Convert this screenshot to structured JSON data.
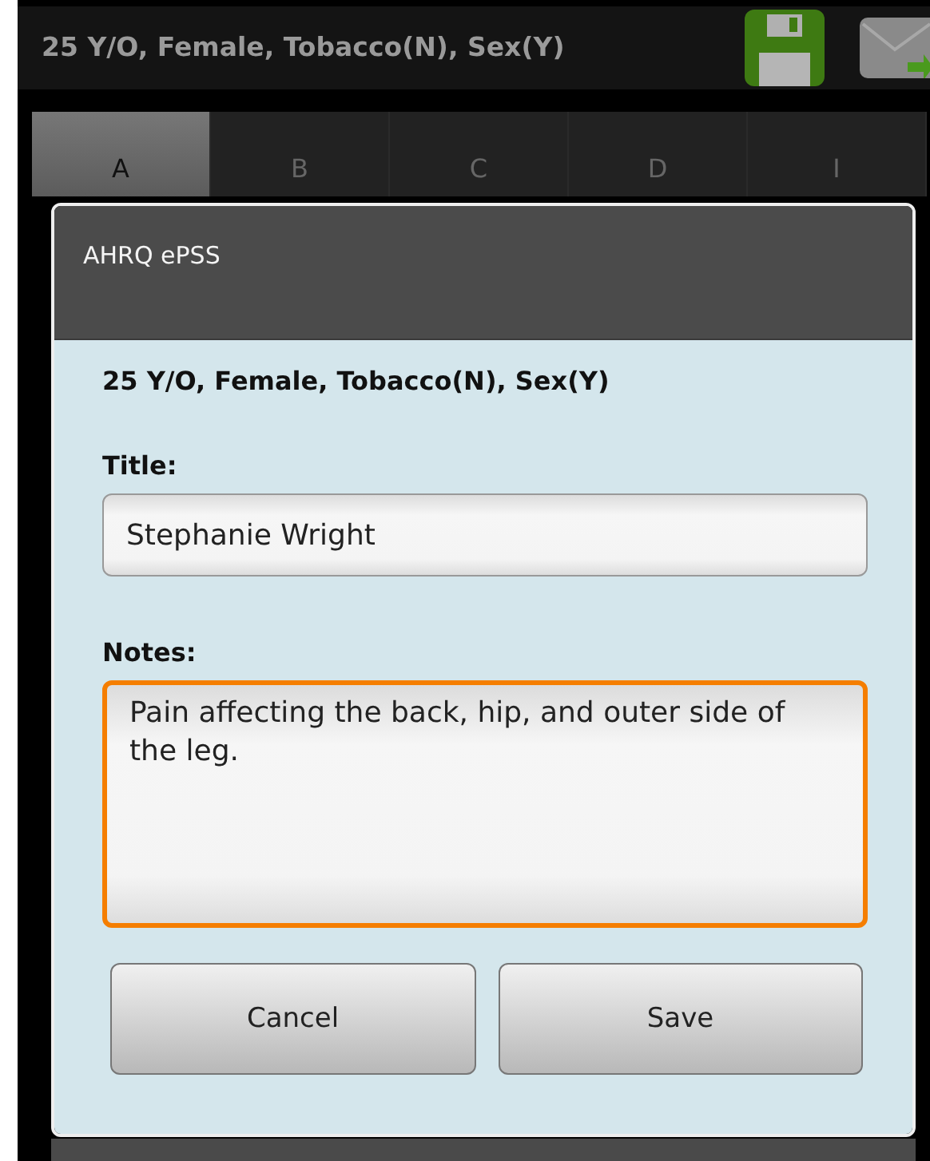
{
  "action_bar": {
    "title": "25 Y/O, Female, Tobacco(N), Sex(Y)"
  },
  "tabs": [
    {
      "label": "A",
      "selected": true
    },
    {
      "label": "B",
      "selected": false
    },
    {
      "label": "C",
      "selected": false
    },
    {
      "label": "D",
      "selected": false
    },
    {
      "label": "I",
      "selected": false
    }
  ],
  "dialog": {
    "title": "AHRQ ePSS",
    "subtitle": "25 Y/O, Female, Tobacco(N), Sex(Y)",
    "fields": [
      {
        "kind": "line",
        "label": "Title:",
        "value": "Stephanie Wright",
        "focused": false
      },
      {
        "kind": "multiline",
        "label": "Notes:",
        "value": "Pain affecting the back, hip, and outer side of the leg.",
        "focused": true
      }
    ],
    "buttons": [
      "Cancel",
      "Save"
    ]
  }
}
